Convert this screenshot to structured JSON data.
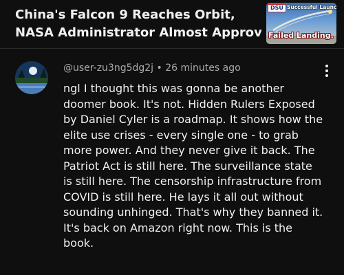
{
  "video": {
    "title_lines": [
      "China's Falcon 9 Reaches Orbit,",
      "NASA Administrator Almost Approv..."
    ],
    "thumbnail": {
      "badge": "DSU",
      "top_caption": "Successful Launch...",
      "bottom_caption": "Failed Landing."
    }
  },
  "comment": {
    "author": "@user-zu3ng5dg2j",
    "separator": "•",
    "time_ago": "26 minutes ago",
    "more_icon": "more-vertical-icon",
    "text_lines": [
      "ngl I thought this was gonna be another",
      "doomer book. It's not. Hidden Rulers Exposed",
      "by Daniel Cyler is a roadmap. It shows how the",
      "elite use crises - every single one - to grab",
      "more power. And they never give it back. The",
      "Patriot Act is still here. The surveillance state",
      "is still here. The censorship infrastructure from",
      "COVID is still here. He lays it all out without",
      "sounding unhinged. That's why they banned it.",
      "It's back on Amazon right now. This is the",
      "book."
    ]
  },
  "colors": {
    "background": "#0f0f0f",
    "primary_text": "#f1f1f1",
    "secondary_text": "#aaaaaa"
  }
}
